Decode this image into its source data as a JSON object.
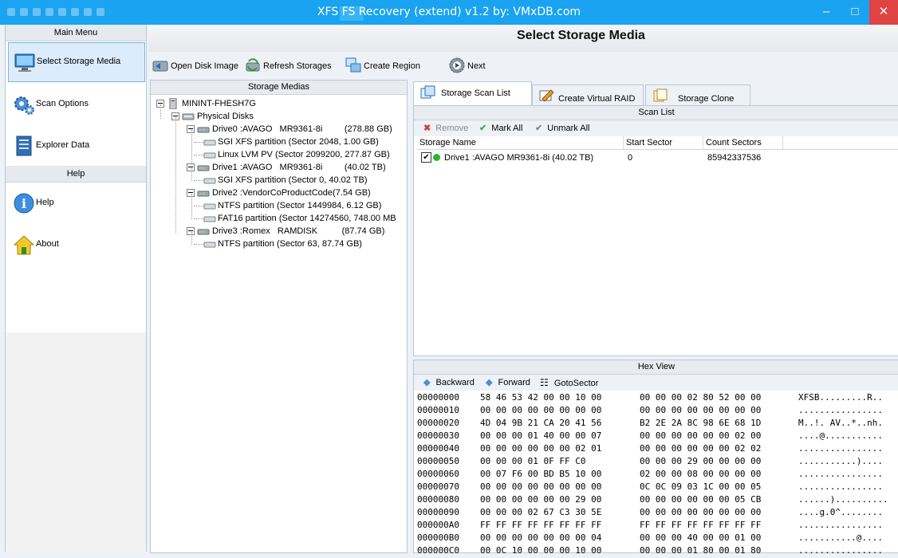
{
  "window": {
    "title": "XFS FS Recovery (extend) v1.2 by: VMxDB.com",
    "controls": [
      "–",
      "□",
      "✕"
    ]
  },
  "left_menu": {
    "main_header": "Main Menu",
    "items": [
      {
        "label": "Select Storage Media",
        "icon": "monitor-icon"
      },
      {
        "label": "Scan Options",
        "icon": "gears-icon"
      },
      {
        "label": "Explorer Data",
        "icon": "document-icon"
      }
    ],
    "help_header": "Help",
    "help_items": [
      {
        "label": "Help",
        "icon": "info-icon"
      },
      {
        "label": "About",
        "icon": "home-icon"
      }
    ]
  },
  "header": {
    "title": "Select Storage Media"
  },
  "toolbar": {
    "open_disk_image": "Open Disk Image",
    "refresh_storages": "Refresh Storages",
    "create_region": "Create Region",
    "next": "Next"
  },
  "medias": {
    "header": "Storage Medias",
    "tree": [
      {
        "text": "MININT-FHESH7G",
        "level": 0,
        "icon": "computer-icon",
        "expander": true
      },
      {
        "text": "Physical Disks",
        "level": 1,
        "icon": "disks-icon",
        "expander": true
      },
      {
        "text": "Drive0 :AVAGO   MR9361-8i         (278.88 GB)",
        "level": 2,
        "icon": "drive-icon",
        "expander": true
      },
      {
        "text": "SGI XFS partition (Sector 2048, 1.00 GB)",
        "level": 3,
        "icon": "partition-icon",
        "expander": false
      },
      {
        "text": "Linux LVM PV (Sector 2099200, 277.87 GB)",
        "level": 3,
        "icon": "partition-icon",
        "expander": false
      },
      {
        "text": "Drive1 :AVAGO   MR9361-8i         (40.02 TB)",
        "level": 2,
        "icon": "drive-icon",
        "expander": true
      },
      {
        "text": "SGI XFS partition (Sector 0, 40.02 TB)",
        "level": 3,
        "icon": "partition-icon",
        "expander": false
      },
      {
        "text": "Drive2 :VendorCoProductCode(7.54 GB)",
        "level": 2,
        "icon": "drive-icon",
        "expander": true
      },
      {
        "text": "NTFS partition (Sector 1449984, 6.12 GB)",
        "level": 3,
        "icon": "partition-icon",
        "expander": false
      },
      {
        "text": "FAT16 partition (Sector 14274560, 748.00 MB",
        "level": 3,
        "icon": "partition-icon",
        "expander": false
      },
      {
        "text": "Drive3 :Romex   RAMDISK          (87.74 GB)",
        "level": 2,
        "icon": "drive-icon",
        "expander": true
      },
      {
        "text": "NTFS partition (Sector 63, 87.74 GB)",
        "level": 3,
        "icon": "partition-icon",
        "expander": false
      }
    ]
  },
  "tabs": [
    {
      "label": "Storage Scan List",
      "icon": "scan-list-icon",
      "active": true
    },
    {
      "label": "Create Virtual RAID",
      "icon": "raid-icon",
      "active": false
    },
    {
      "label": "Storage Clone",
      "icon": "clone-icon",
      "active": false
    }
  ],
  "scan_list": {
    "header": "Scan List",
    "remove": "Remove",
    "mark_all": "Mark All",
    "unmark_all": "Unmark All",
    "columns": [
      "Storage Name",
      "Start Sector",
      "Count Sectors"
    ],
    "rows": [
      {
        "name": "Drive1 :AVAGO   MR9361-8i         (40.02 TB)",
        "start": "0",
        "count": "85942337536",
        "checked": true,
        "status_color": "#2db52d"
      }
    ]
  },
  "hex_view": {
    "header": "Hex View",
    "backward": "Backward",
    "forward": "Forward",
    "goto": "GotoSector",
    "rows": [
      {
        "offset": "00000000",
        "hex1": "58 46 53 42 00 00 10 00",
        "hex2": "00 00 00 02 80 52 00 00",
        "ascii": "XFSB.........R.."
      },
      {
        "offset": "00000010",
        "hex1": "00 00 00 00 00 00 00 00",
        "hex2": "00 00 00 00 00 00 00 00",
        "ascii": "................"
      },
      {
        "offset": "00000020",
        "hex1": "4D 04 9B 21 CA 20 41 56",
        "hex2": "B2 2E 2A 8C 98 6E 68 1D",
        "ascii": "M..!. AV..*..nh."
      },
      {
        "offset": "00000030",
        "hex1": "00 00 00 01 40 00 00 07",
        "hex2": "00 00 00 00 00 00 02 00",
        "ascii": "....@..........."
      },
      {
        "offset": "00000040",
        "hex1": "00 00 00 00 00 00 02 01",
        "hex2": "00 00 00 00 00 00 02 02",
        "ascii": "................"
      },
      {
        "offset": "00000050",
        "hex1": "00 00 00 01 0F FF C0",
        "hex2": "00 00 00 29 00 00 00 00",
        "ascii": "...........)...."
      },
      {
        "offset": "00000060",
        "hex1": "00 07 F6 00 BD B5 10 00",
        "hex2": "02 00 00 08 00 00 00 00",
        "ascii": "................"
      },
      {
        "offset": "00000070",
        "hex1": "00 00 00 00 00 00 00 00",
        "hex2": "0C 0C 09 03 1C 00 00 05",
        "ascii": "................"
      },
      {
        "offset": "00000080",
        "hex1": "00 00 00 00 00 00 29 00",
        "hex2": "00 00 00 00 00 00 05 CB",
        "ascii": "......).........."
      },
      {
        "offset": "00000090",
        "hex1": "00 00 00 02 67 C3 30 5E",
        "hex2": "00 00 00 00 00 00 00 00",
        "ascii": "....g.0^........"
      },
      {
        "offset": "000000A0",
        "hex1": "FF FF FF FF FF FF FF FF",
        "hex2": "FF FF FF FF FF FF FF FF",
        "ascii": "................"
      },
      {
        "offset": "000000B0",
        "hex1": "00 00 00 00 00 00 00 04",
        "hex2": "00 00 00 40 00 00 01 00",
        "ascii": "...........@...."
      },
      {
        "offset": "000000C0",
        "hex1": "00 0C 10 00 00 00 10 00",
        "hex2": "00 00 00 01 80 00 01 80",
        "ascii": "................"
      }
    ]
  }
}
